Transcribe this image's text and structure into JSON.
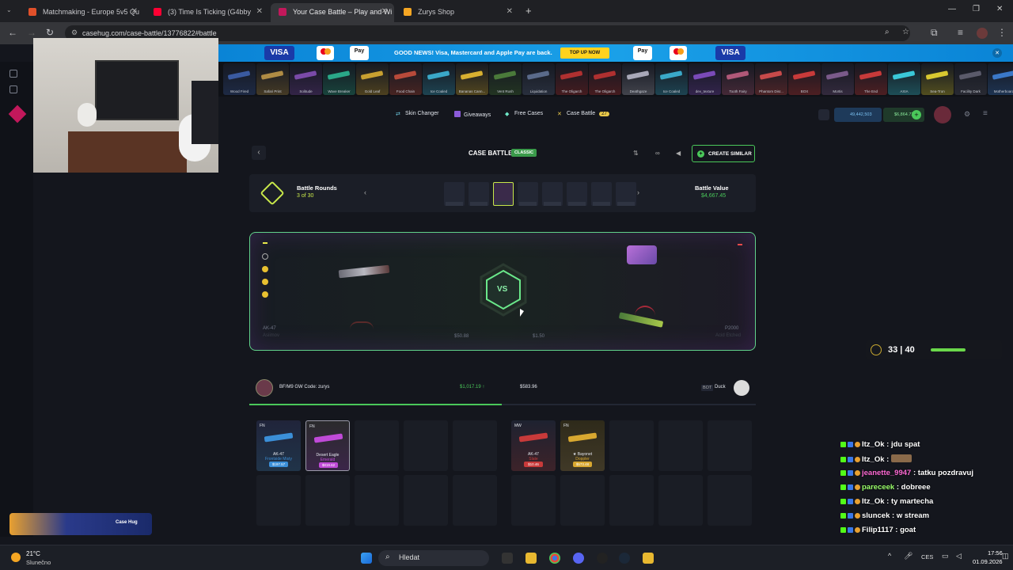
{
  "browser": {
    "tabs": [
      {
        "title": "Matchmaking - Europe 5v5 Qu",
        "color": "#e0502a"
      },
      {
        "title": "(3) Time Is Ticking (G4bby",
        "color": "#ff0033"
      },
      {
        "title": "Your Case Battle – Play and Wi",
        "color": "#c2185b"
      },
      {
        "title": "Zurys Shop",
        "color": "#f5a623"
      }
    ],
    "url": "casehug.com/case-battle/13776822#battle"
  },
  "promo": {
    "text": "GOOD NEWS! Visa, Mastercard and Apple Pay are back.",
    "button": "TOP UP NOW",
    "visa": "VISA",
    "applepay": "Pay"
  },
  "live_drops": [
    {
      "name": "Wood Fired",
      "color": "#3a5aa0"
    },
    {
      "name": "Safari Print",
      "color": "#b08c44"
    },
    {
      "name": "Solitude",
      "color": "#7a4aa8"
    },
    {
      "name": "Wave Breaker",
      "color": "#2aa888"
    },
    {
      "name": "Gold Leaf",
      "color": "#c8a030"
    },
    {
      "name": "Food Chain",
      "color": "#b84a3a"
    },
    {
      "name": "Ice Coaled",
      "color": "#3aa8c8"
    },
    {
      "name": "Bananas Cann...",
      "color": "#d8b030"
    },
    {
      "name": "Vent Rush",
      "color": "#4a7a3a"
    },
    {
      "name": "Liquidation",
      "color": "#5a6a8a"
    },
    {
      "name": "The Oligarch",
      "color": "#b03030"
    },
    {
      "name": "The Oligarch",
      "color": "#b03030"
    },
    {
      "name": "Deathgaze",
      "color": "#a8a8b8"
    },
    {
      "name": "Ice Coaled",
      "color": "#3aa8c8"
    },
    {
      "name": "dev_texture",
      "color": "#7a4ab8"
    },
    {
      "name": "Tooth Fairy",
      "color": "#b05878"
    },
    {
      "name": "Phantom Disr...",
      "color": "#c84a4a"
    },
    {
      "name": "BOX",
      "color": "#c83a3a"
    },
    {
      "name": "Mortis",
      "color": "#7a5a8a"
    },
    {
      "name": "The End",
      "color": "#c83a3a"
    },
    {
      "name": "AXIA",
      "color": "#3ac8d8"
    },
    {
      "name": "Sea-Tron",
      "color": "#d8c830"
    },
    {
      "name": "Facility Dark",
      "color": "#5a5a6a"
    },
    {
      "name": "Motherboard",
      "color": "#3a78c8"
    }
  ],
  "site_nav": {
    "skin_changer": "Skin Changer",
    "giveaways": "Giveaways",
    "free_cases": "Free Cases",
    "case_battle": "Case Battle",
    "case_battle_badge": "27",
    "coins": "49,442,503",
    "balance": "$6,864.72"
  },
  "battle": {
    "title": "CASE BATTLE",
    "mode": "CLASSIC",
    "create_similar": "CREATE SIMILAR",
    "rounds_label": "Battle Rounds",
    "rounds_value": "3 of 30",
    "value_label": "Battle Value",
    "value": "$4,667.45",
    "vs": "VS",
    "left_item": "AK-47",
    "left_sub": "Asiimov",
    "right_item": "P2000",
    "right_sub": "Acid Etched",
    "left_price": "$50.88",
    "right_price": "$1.50"
  },
  "players": {
    "p1_name": "BF/M9 GW Code: zurys",
    "p1_total": "$1,017.19",
    "p2_total": "$583.96",
    "p2_tag": "BOT",
    "p2_name": "Duck"
  },
  "p1_items": [
    {
      "quality": "FN",
      "name": "AK-47",
      "sub": "Frontside Misty",
      "price": "$197.57",
      "color": "#3b8fd8",
      "bg": "#20243a"
    },
    {
      "quality": "FN",
      "name": "Desert Eagle",
      "sub": "Emerald",
      "price": "$819.62",
      "color": "#c04ad8",
      "bg": "#2a2a2c"
    }
  ],
  "p2_items": [
    {
      "quality": "MW",
      "name": "AK-47",
      "sub": "Slate",
      "price": "$10.46",
      "color": "#c83a3a",
      "bg": "#1e2230"
    },
    {
      "quality": "FN",
      "name": "★ Bayonet",
      "sub": "Doppler",
      "price": "$573.48",
      "color": "#d8a830",
      "bg": "#2e2a1a"
    }
  ],
  "stream_widget": {
    "value1": "33",
    "value2": "40"
  },
  "overlay_brand": "Case Hug",
  "chat": [
    {
      "user": "Itz_Ok",
      "color": "#ffffff",
      "msg": "jdu spat"
    },
    {
      "user": "Itz_Ok",
      "color": "#ffffff",
      "msg": ""
    },
    {
      "user": "jeanette_9947",
      "color": "#ff6ad5",
      "msg": "tatku pozdravuj"
    },
    {
      "user": "pareceek",
      "color": "#9aff6a",
      "msg": "dobreee"
    },
    {
      "user": "Itz_Ok",
      "color": "#ffffff",
      "msg": "ty martecha"
    },
    {
      "user": "sluncek",
      "color": "#ffffff",
      "msg": "w stream"
    },
    {
      "user": "Filip1117",
      "color": "#ffffff",
      "msg": "goat"
    }
  ],
  "taskbar": {
    "temp": "21°C",
    "weather": "Slunečno",
    "search": "Hledat",
    "lang": "CES",
    "time": "17:56",
    "date": "01.09.2026"
  }
}
